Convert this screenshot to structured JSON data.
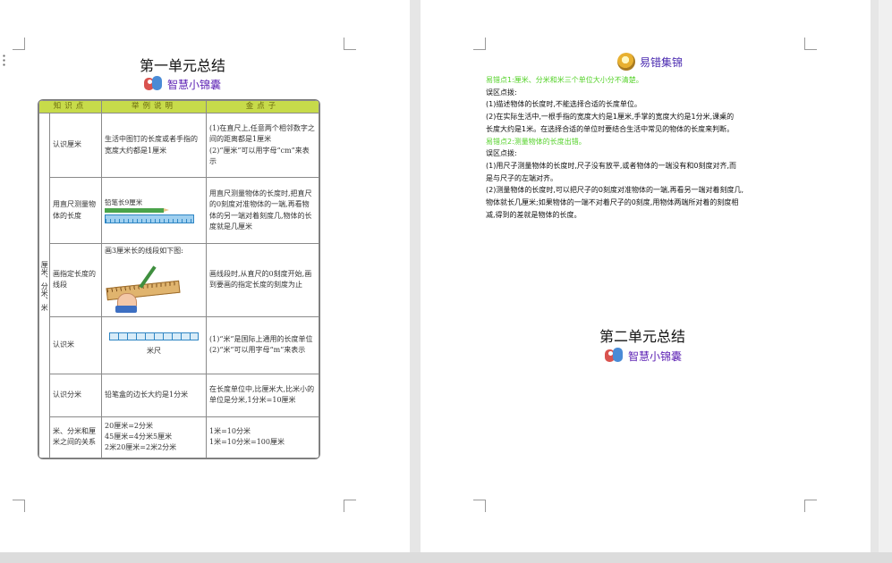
{
  "page1": {
    "title": "第一单元总结",
    "subhead": "智慧小锦囊",
    "table": {
      "headers": [
        "知识点",
        "举例说明",
        "金点子"
      ],
      "side_label": "厘米、分米、米",
      "rows": [
        {
          "topic": "认识厘米",
          "example": "生活中图钉的长度或者手指的宽度大约都是1厘米",
          "tips": [
            "(1)在直尺上,任意两个相邻数字之间的距离都是1厘米",
            "(2)“厘米”可以用字母“cm”来表示"
          ]
        },
        {
          "topic": "用直尺测量物体的长度",
          "example_label": "铅笔长9厘米",
          "tips": [
            "用直尺测量物体的长度时,把直尺的0刻度对准物体的一端,再看物体的另一端对着刻度几,物体的长度就是几厘米"
          ]
        },
        {
          "topic": "画指定长度的线段",
          "example": "画3厘米长的线段如下图:",
          "tips": [
            "画线段时,从直尺的0刻度开始,画到要画的指定长度的刻度为止"
          ]
        },
        {
          "topic": "认识米",
          "example_label": "米尺",
          "tips": [
            "(1)“米”是国际上通用的长度单位",
            "(2)“米”可以用字母“m”来表示"
          ]
        },
        {
          "topic": "认识分米",
          "example": "铅笔盒的边长大约是1分米",
          "tips": [
            "在长度单位中,比厘米大,比米小的单位是分米,1分米=10厘米"
          ]
        },
        {
          "topic": "米、分米和厘米之间的关系",
          "example_lines": [
            "20厘米=2分米",
            "45厘米=4分米5厘米",
            "2米20厘米=2米2分米"
          ],
          "tips": [
            "1米=10分米",
            "1米=10分米=100厘米"
          ]
        }
      ]
    }
  },
  "page2": {
    "heading": "易错集锦",
    "lines": [
      {
        "text": "易错点1:厘米、分米和米三个单位大小分不清楚。",
        "highlight": true
      },
      {
        "text": "误区点拨:",
        "highlight": false
      },
      {
        "text": "(1)描述物体的长度时,不能选择合适的长度单位。",
        "highlight": false
      },
      {
        "text": "(2)在实际生活中,一根手指的宽度大约是1厘米,手掌的宽度大约是1分米,课桌的",
        "highlight": false
      },
      {
        "text": "长度大约是1米。在选择合适的单位时要结合生活中常见的物体的长度来判断。",
        "highlight": false
      },
      {
        "text": "易错点2:测量物体的长度出错。",
        "highlight": true
      },
      {
        "text": "误区点拨:",
        "highlight": false
      },
      {
        "text": "(1)用尺子测量物体的长度时,尺子没有放平,或者物体的一端没有和0刻度对齐,而",
        "highlight": false
      },
      {
        "text": "是与尺子的左端对齐。",
        "highlight": false
      },
      {
        "text": "(2)测量物体的长度时,可以把尺子的0刻度对准物体的一端,再看另一端对着刻度几,",
        "highlight": false
      },
      {
        "text": "物体就长几厘米;如果物体的一端不对着尺子的0刻度,用物体两端所对着的刻度相",
        "highlight": false
      },
      {
        "text": "减,得到的差就是物体的长度。",
        "highlight": false
      }
    ],
    "title2": "第二单元总结",
    "subhead2": "智慧小锦囊"
  },
  "colors": {
    "table_header": "#c7db4a",
    "subhead": "#5b1fb3",
    "highlight": "#55d22a",
    "page_bg": "#ffffff",
    "workspace_bg": "#e6e6e6"
  }
}
